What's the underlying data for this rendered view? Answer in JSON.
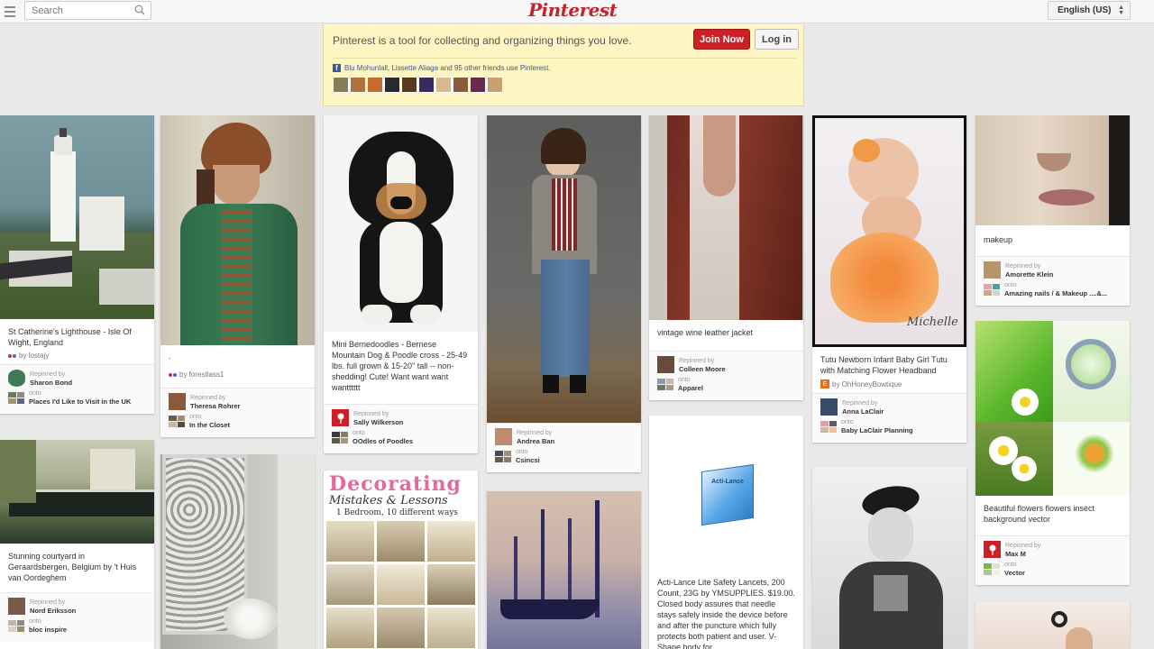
{
  "header": {
    "search_placeholder": "Search",
    "logo": "Pinterest",
    "language": "English (US)"
  },
  "banner": {
    "text": "Pinterest is a tool for collecting and organizing things you love.",
    "join_label": "Join Now",
    "login_label": "Log in",
    "friend1": "Blu Mohunlall",
    "friend2": "Lissette Aliaga",
    "friends_suffix": "and 95 other friends use",
    "friends_site": "Pinterest."
  },
  "pins": [
    {
      "desc": "St Catherine's Lighthouse - Isle Of Wight, England",
      "by": "by lostajy",
      "repinned_label": "Repinned by",
      "user": "Sharon Bond",
      "onto_label": "onto",
      "board": "Places I'd Like to Visit in the UK"
    },
    {
      "desc": ".",
      "by": "by forestlass1",
      "repinned_label": "Repinned by",
      "user": "Theresa Rohrer",
      "onto_label": "onto",
      "board": "In the Closet"
    },
    {
      "desc": "Mini Bernedoodles - Bernese Mountain Dog & Poodle cross - 25-49 lbs. full grown & 15-20\" tall -- non-shedding! Cute! Want want want wantttttt",
      "repinned_label": "Repinned by",
      "user": "Sally Wilkerson",
      "onto_label": "onto",
      "board": "OOdles of Poodles"
    },
    {
      "repinned_label": "Repinned by",
      "user": "Andrea Ban",
      "onto_label": "onto",
      "board": "Csincsi"
    },
    {
      "desc": "vintage wine leather jacket",
      "repinned_label": "Repinned by",
      "user": "Colleen Moore",
      "onto_label": "onto",
      "board": "Apparel"
    },
    {
      "desc": "Tutu Newborn Infant Baby Girl Tutu with Matching Flower Headband",
      "by": "by OhHoneyBowtique",
      "repinned_label": "Repinned by",
      "user": "Anna LaClair",
      "onto_label": "onto",
      "board": "Baby LaClair Planning",
      "watermark": "Michelle"
    },
    {
      "desc": "makeup",
      "repinned_label": "Repinned by",
      "user": "Amorette Klein",
      "onto_label": "onto",
      "board": "Amazing nails / & Makeup ....&..."
    },
    {
      "desc": "Stunning courtyard in Geraardsbergen, Belgium by 't Huis van Oordeghem",
      "repinned_label": "Repinned by",
      "user": "Nord Eriksson",
      "onto_label": "onto",
      "board": "bloc inspire"
    },
    {
      "title": "Decorating",
      "subtitle": "Mistakes & Lessons",
      "caption": "1 Bedroom, 10 different ways"
    },
    {
      "desc": "Acti-Lance Lite Safety Lancets, 200 Count, 23G by YMSUPPLIES. $19.00. Closed body assures that needle stays safely inside the device before and after the puncture which fully protects both patient and user. V-Shape body for",
      "box_label": "Acti-Lance"
    },
    {
      "desc": "Beautiful flowers flowers insect background vector",
      "repinned_label": "Repinned by",
      "user": "Max M",
      "onto_label": "onto",
      "board": "Vector"
    }
  ],
  "colors": {
    "brand_red": "#cb2027",
    "facebook_blue": "#3b5998",
    "banner_bg": "#fdf6c2"
  }
}
